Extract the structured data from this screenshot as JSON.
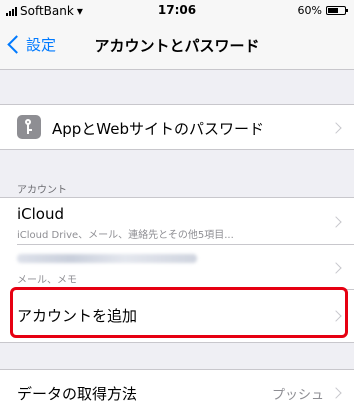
{
  "status_bar": {
    "carrier": "SoftBank",
    "time": "17:06",
    "battery": "60%",
    "battery_level": 0.6
  },
  "nav": {
    "back_label": "設定",
    "title": "アカウントとパスワード"
  },
  "passwords_row": {
    "label": "AppとWebサイトのパスワード",
    "icon": "key-icon"
  },
  "accounts_section": {
    "header": "アカウント",
    "items": [
      {
        "title": "iCloud",
        "subtitle": "iCloud Drive、メール、連絡先とその他5項目..."
      },
      {
        "title": "",
        "subtitle": "メール、メモ"
      }
    ],
    "add_account": "アカウントを追加"
  },
  "fetch_row": {
    "label": "データの取得方法",
    "value": "プッシュ"
  },
  "highlight_color": "#e60012",
  "accent_color": "#007aff"
}
